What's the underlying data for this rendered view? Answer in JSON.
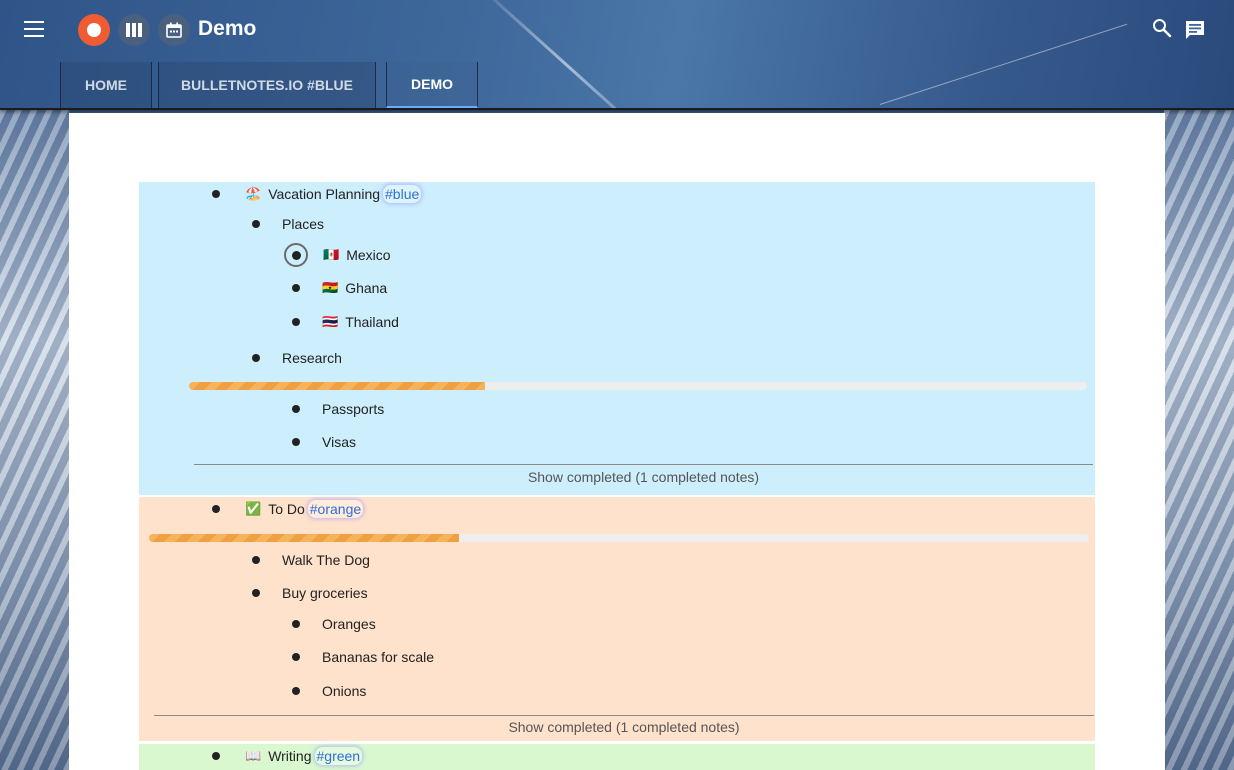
{
  "header": {
    "title": "Demo",
    "tabs": [
      {
        "label": "HOME",
        "active": false
      },
      {
        "label": "BULLETNOTES.IO #BLUE",
        "active": false
      },
      {
        "label": "DEMO",
        "active": true
      }
    ],
    "icons": [
      "menu-icon",
      "record-icon",
      "columns-icon",
      "calendar-icon",
      "search-icon",
      "chat-icon"
    ]
  },
  "colors": {
    "record": "#ef5b33",
    "blue_section": "#cdeefc",
    "orange_section": "#ffe2cb",
    "green_section": "#d9f8d0",
    "tag_text": "#2f6fd6",
    "progress_fill": "#f0a040"
  },
  "notes": {
    "vacation": {
      "emoji": "🏖️",
      "label": "Vacation Planning",
      "tag": "#blue",
      "places": {
        "label": "Places",
        "items": [
          {
            "flag": "🇲🇽",
            "label": "Mexico"
          },
          {
            "flag": "🇬🇭",
            "label": "Ghana"
          },
          {
            "flag": "🇹🇭",
            "label": "Thailand"
          }
        ]
      },
      "research": {
        "label": "Research",
        "progress": 0.33,
        "items": [
          {
            "label": "Passports"
          },
          {
            "label": "Visas"
          }
        ]
      },
      "show_completed": "Show completed (1 completed notes)"
    },
    "todo": {
      "emoji": "✅",
      "label": "To Do",
      "tag": "#orange",
      "progress": 0.33,
      "items": [
        {
          "label": "Walk The Dog"
        },
        {
          "label": "Buy groceries"
        }
      ],
      "groceries": [
        {
          "label": "Oranges"
        },
        {
          "label": "Bananas for scale"
        },
        {
          "label": "Onions"
        }
      ],
      "show_completed": "Show completed (1 completed notes)"
    },
    "writing": {
      "emoji": "📖",
      "label": "Writing",
      "tag": "#green"
    }
  }
}
